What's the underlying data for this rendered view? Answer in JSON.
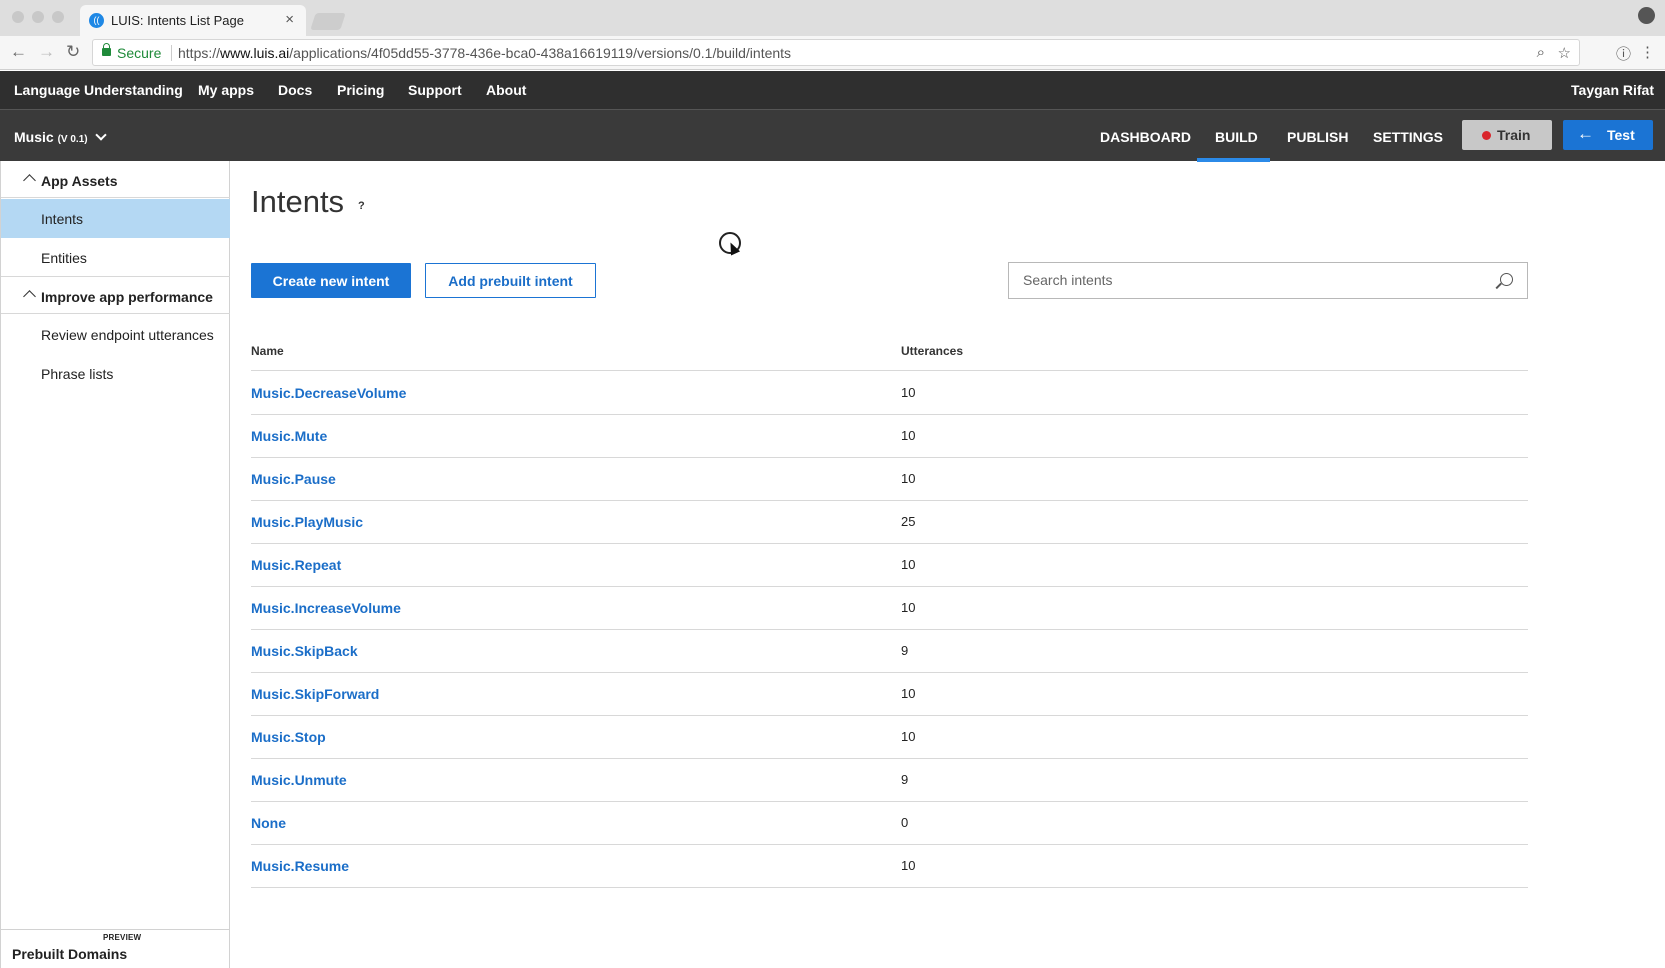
{
  "browser": {
    "tab_title": "LUIS: Intents List Page",
    "tab_close": "×",
    "secure_label": "Secure",
    "url_scheme": "https://",
    "url_host": "www.luis.ai",
    "url_path": "/applications/4f05dd55-3778-436e-bca0-438a16619119/versions/0.1/build/intents"
  },
  "topnav": {
    "brand": "Language Understanding",
    "links": [
      "My apps",
      "Docs",
      "Pricing",
      "Support",
      "About"
    ],
    "user": "Taygan Rifat"
  },
  "appbar": {
    "app_name": "Music",
    "app_version": "(V 0.1)",
    "tabs": [
      "DASHBOARD",
      "BUILD",
      "PUBLISH",
      "SETTINGS"
    ],
    "active_tab": "BUILD",
    "train_label": "Train",
    "test_label": "Test",
    "train_dot_color": "#d9252b",
    "accent": "#1b74d4"
  },
  "sidebar": {
    "sections": [
      {
        "label": "App Assets",
        "items": [
          "Intents",
          "Entities"
        ]
      },
      {
        "label": "Improve app performance",
        "items": [
          "Review endpoint utterances",
          "Phrase lists"
        ]
      }
    ],
    "active_item": "Intents",
    "footer_label": "Prebuilt Domains",
    "footer_tag": "PREVIEW"
  },
  "main": {
    "title": "Intents",
    "help": "?",
    "create_button": "Create new intent",
    "prebuilt_button": "Add prebuilt intent",
    "search_placeholder": "Search intents",
    "columns": [
      "Name",
      "Utterances"
    ],
    "rows": [
      {
        "name": "Music.DecreaseVolume",
        "utterances": "10"
      },
      {
        "name": "Music.Mute",
        "utterances": "10"
      },
      {
        "name": "Music.Pause",
        "utterances": "10"
      },
      {
        "name": "Music.PlayMusic",
        "utterances": "25"
      },
      {
        "name": "Music.Repeat",
        "utterances": "10"
      },
      {
        "name": "Music.IncreaseVolume",
        "utterances": "10"
      },
      {
        "name": "Music.SkipBack",
        "utterances": "9"
      },
      {
        "name": "Music.SkipForward",
        "utterances": "10"
      },
      {
        "name": "Music.Stop",
        "utterances": "10"
      },
      {
        "name": "Music.Unmute",
        "utterances": "9"
      },
      {
        "name": "None",
        "utterances": "0"
      },
      {
        "name": "Music.Resume",
        "utterances": "10"
      }
    ]
  }
}
